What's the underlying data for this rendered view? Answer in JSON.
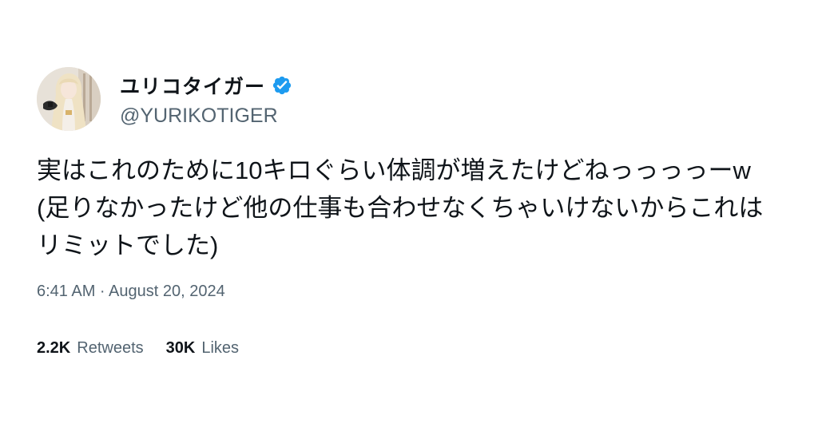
{
  "tweet": {
    "author": {
      "display_name": "ユリコタイガー",
      "handle": "@YURIKOTIGER",
      "verified_icon": "verified-badge-icon",
      "avatar": "profile-photo"
    },
    "text": "実はこれのために10キロぐらい体調が増えたけどねっっっっーw(足りなかったけど他の仕事も合わせなくちゃいけないからこれはリミットでした)",
    "timestamp": "6:41 AM · August 20, 2024",
    "stats": {
      "retweets_count": "2.2K",
      "retweets_label": "Retweets",
      "likes_count": "30K",
      "likes_label": "Likes"
    }
  },
  "colors": {
    "text_primary": "#0f1419",
    "text_secondary": "#536471",
    "verified_blue": "#1d9bf0",
    "background": "#ffffff"
  }
}
